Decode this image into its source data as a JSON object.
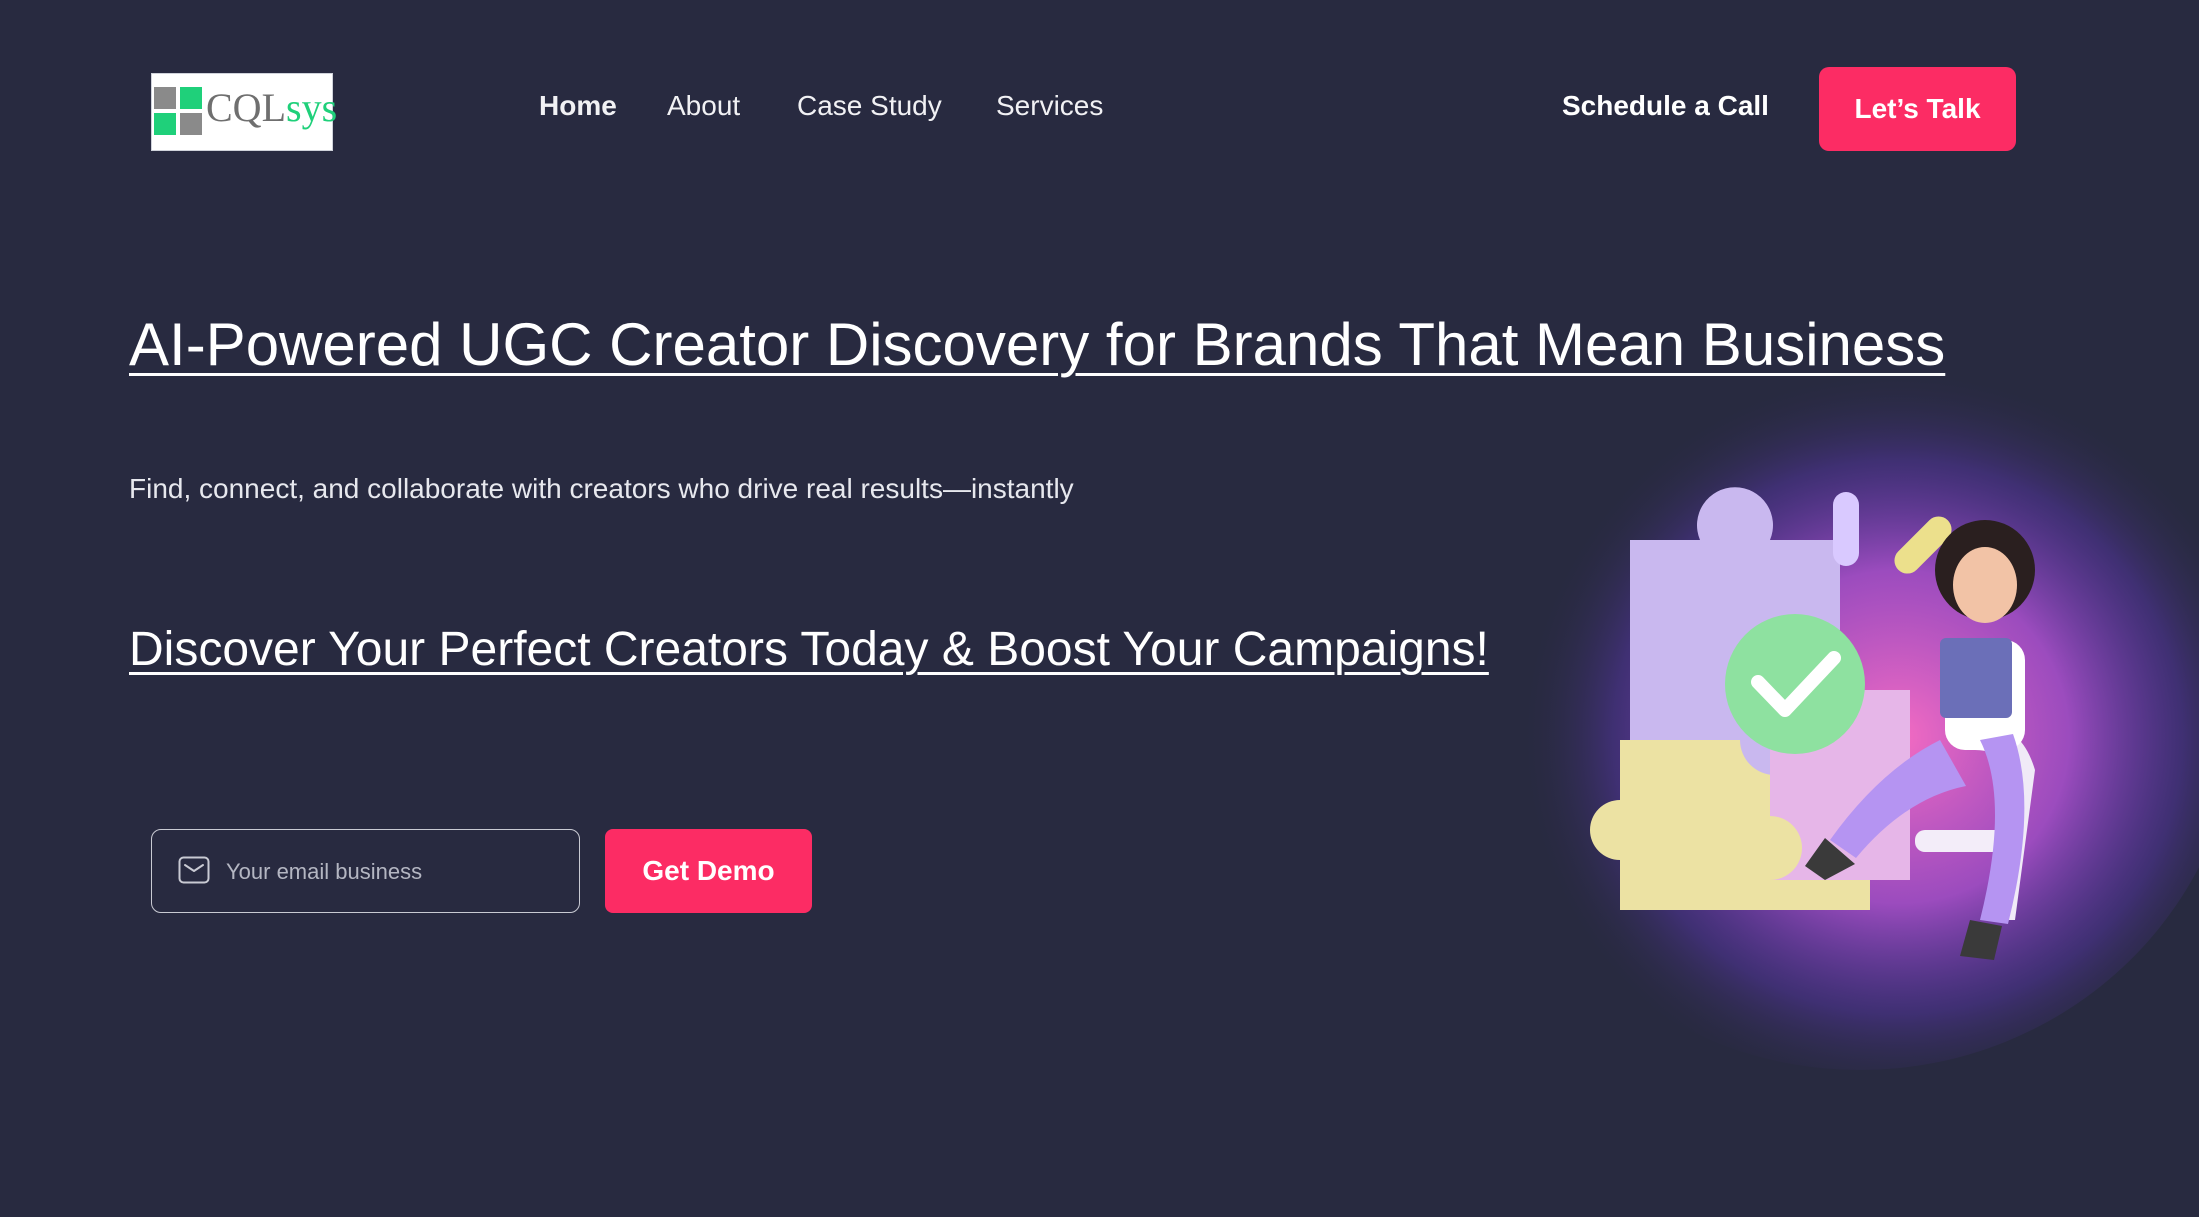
{
  "header": {
    "logo": {
      "text_main": "CQL",
      "text_accent": "sys"
    },
    "nav": [
      {
        "label": "Home",
        "active": true
      },
      {
        "label": "About",
        "active": false
      },
      {
        "label": "Case Study",
        "active": false
      },
      {
        "label": "Services",
        "active": false
      }
    ],
    "schedule_label": "Schedule a Call",
    "talk_label": "Let’s Talk"
  },
  "hero": {
    "headline": "AI-Powered UGC Creator Discovery for Brands That Mean Business",
    "subtitle": "Find, connect, and collaborate with creators who drive real results—instantly",
    "cta_link": "Discover Your Perfect Creators Today & Boost Your Campaigns!",
    "email": {
      "placeholder": "Your email business",
      "value": ""
    },
    "demo_label": "Get Demo",
    "icons": {
      "email": "envelope-icon"
    }
  },
  "colors": {
    "background": "#282a40",
    "accent": "#fc2c64",
    "logo_green": "#1fd07a"
  }
}
